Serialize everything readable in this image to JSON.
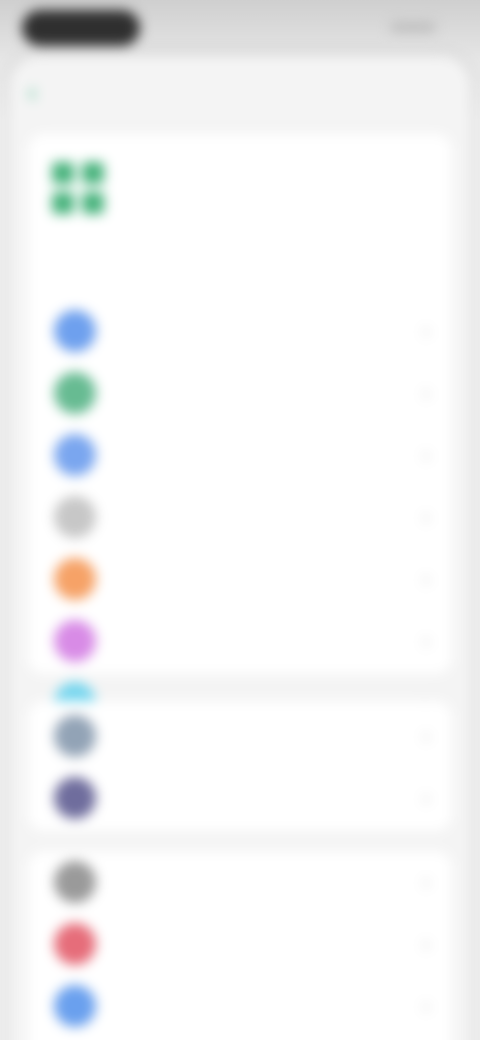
{
  "status": {
    "left_pill": "",
    "right_indicator": ""
  },
  "nav": {
    "back_label": "",
    "title": ""
  },
  "feature": {
    "title": "",
    "subtitle": ""
  },
  "groups": [
    {
      "items": [
        {
          "label": "",
          "icon": "blue-circle-icon",
          "color": "#6ea0ee"
        },
        {
          "label": "",
          "icon": "green-circle-icon",
          "color": "#67bb92"
        },
        {
          "label": "",
          "icon": "blue-circle-icon",
          "color": "#7aa6ef"
        },
        {
          "label": "",
          "icon": "gray-circle-icon",
          "color": "#c7c7c7"
        },
        {
          "label": "",
          "icon": "orange-circle-icon",
          "color": "#f6a267"
        },
        {
          "label": "",
          "icon": "purple-circle-icon",
          "color": "#d88be6"
        },
        {
          "label": "",
          "icon": "cyan-circle-icon",
          "color": "#74d5ee"
        }
      ]
    },
    {
      "items": [
        {
          "label": "",
          "icon": "slate-circle-icon",
          "color": "#92a3b6"
        },
        {
          "label": "",
          "icon": "indigo-circle-icon",
          "color": "#6f6d9d"
        }
      ]
    },
    {
      "items": [
        {
          "label": "",
          "icon": "gray-circle-icon",
          "color": "#9a9a9a"
        },
        {
          "label": "",
          "icon": "red-circle-icon",
          "color": "#e66d7a"
        },
        {
          "label": "",
          "icon": "blue-circle-icon",
          "color": "#6aa0ee"
        }
      ]
    }
  ],
  "colors": {
    "accent": "#2db178",
    "sheet_background": "#f4f4f4",
    "card_background": "#ffffff"
  }
}
